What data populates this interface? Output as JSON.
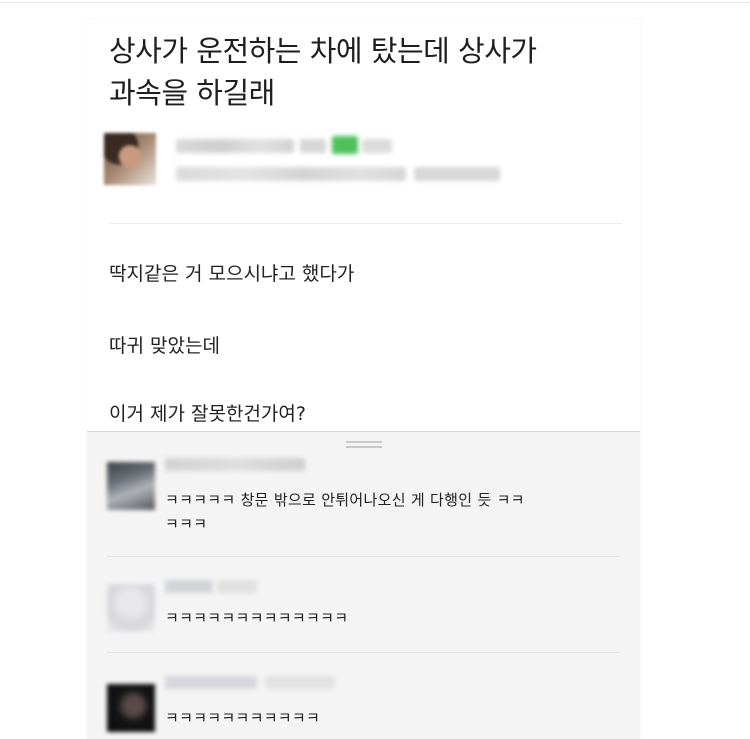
{
  "post": {
    "title_line1": "상사가 운전하는 차에 탔는데 상사가",
    "title_line2": "과속을 하길래",
    "body": [
      "딱지같은 거 모으시냐고 했다가",
      "따귀 맞았는데",
      "이거 제가 잘못한건가여?"
    ]
  },
  "comments": [
    {
      "text_line1": "ㅋㅋㅋㅋㅋ 창문 밖으로 안튀어나오신 게 다행인 듯 ㅋㅋ",
      "text_line2": "ㅋㅋㅋ"
    },
    {
      "text_line1": "ㅋㅋㅋㅋㅋㅋㅋㅋㅋㅋㅋㅋㅋ",
      "text_line2": ""
    },
    {
      "text_line1": "ㅋㅋㅋㅋㅋㅋㅋㅋㅋㅋㅋ",
      "text_line2": ""
    }
  ],
  "colors": {
    "post_bg": "#ffffff",
    "comments_bg": "#f4f4f4",
    "badge_green": "#4cc15a"
  }
}
